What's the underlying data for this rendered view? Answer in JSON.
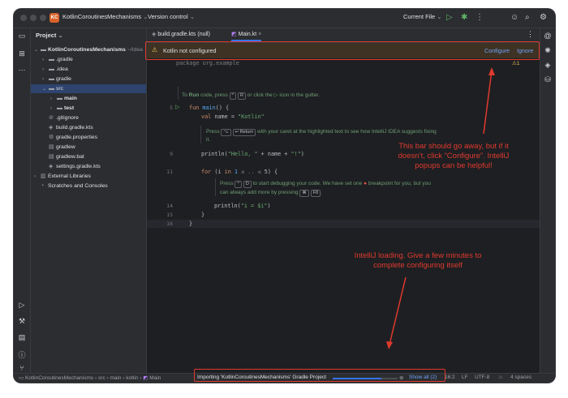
{
  "titlebar": {
    "project_badge": "KC",
    "project_name": "KotlinCoroutinesMechanisms",
    "version_control": "Version control",
    "run_config": "Current File"
  },
  "tool_window": {
    "title": "Project"
  },
  "tree": [
    {
      "label": "KotlinCoroutinesMechanisms",
      "suffix": "~/Idea",
      "chev": "⌄",
      "icon": "folder-icon"
    },
    {
      "label": ".gradle",
      "chev": "›",
      "icon": "folder-icon"
    },
    {
      "label": ".idea",
      "chev": "›",
      "icon": "folder-icon"
    },
    {
      "label": "gradle",
      "chev": "›",
      "icon": "folder-icon"
    },
    {
      "label": "src",
      "chev": "⌄",
      "icon": "folder-icon"
    },
    {
      "label": "main",
      "chev": "›",
      "icon": "folder-icon"
    },
    {
      "label": "test",
      "chev": "›",
      "icon": "folder-icon"
    },
    {
      "label": ".gitignore",
      "chev": "",
      "icon": "file-icon"
    },
    {
      "label": "build.gradle.kts",
      "chev": "",
      "icon": "file-icon"
    },
    {
      "label": "gradle.properties",
      "chev": "",
      "icon": "file-icon"
    },
    {
      "label": "gradlew",
      "chev": "",
      "icon": "file-icon"
    },
    {
      "label": "gradlew.bat",
      "chev": "",
      "icon": "file-icon"
    },
    {
      "label": "settings.gradle.kts",
      "chev": "",
      "icon": "file-icon"
    },
    {
      "label": "External Libraries",
      "chev": "›",
      "icon": "library-icon"
    },
    {
      "label": "Scratches and Consoles",
      "chev": "",
      "icon": "scratch-icon"
    }
  ],
  "tabs": [
    {
      "label": "build.gradle.kts (null)"
    },
    {
      "label": "Main.kt"
    }
  ],
  "notification": {
    "text": "Kotlin not configured",
    "configure": "Configure",
    "ignore": "Ignore"
  },
  "editor": {
    "line1": "package org.example",
    "hint1_a": "To ",
    "hint1_b": "Run",
    "hint1_c": " code, press ",
    "hint1_k1": "^",
    "hint1_k2": "R",
    "hint1_d": " or click the ",
    "hint1_e": " icon in the gutter.",
    "fun": "fun",
    "main": "main",
    "fun_rest": "() {",
    "val": "val",
    "name_eq": " name = ",
    "kotlin_str": "\"Kotlin\"",
    "hint2_a": "Press ",
    "hint2_k1": "⌥",
    "hint2_k2": "↩ Return",
    "hint2_b": " with your caret at the highlighted text to see how IntelliJ IDEA suggests fixing",
    "hint2_c": "it.",
    "println1_a": "println(",
    "println1_b": "\"Hello, \"",
    "println1_c": " + name + ",
    "println1_d": "\"!\"",
    "println1_e": ")",
    "for": "for",
    "for_a": " (i ",
    "for_in": "in",
    "for_b": " 1",
    "for_r": " ≤ .. ≤ ",
    "for_c": "5) {",
    "hint3_a": "Press ",
    "hint3_k1": "^",
    "hint3_k2": "D",
    "hint3_b": " to start debugging your code. We have set one ",
    "hint3_c": " breakpoint for you, but you",
    "hint3_d": "can always add more by pressing ",
    "hint3_k3": "⌘",
    "hint3_k4": "F8",
    "hint3_e": ".",
    "println2_a": "println(",
    "println2_b": "\"i = $i\"",
    "println2_c": ")",
    "close1": "}",
    "close2": "}",
    "gutter": [
      "5",
      "9",
      "11",
      "14",
      "15",
      "16"
    ],
    "warn_count": "1"
  },
  "statusbar": {
    "crumbs": [
      "KotlinCoroutinesMechanisms",
      "src",
      "main",
      "kotlin",
      "Main"
    ],
    "task": "Importing 'KotlinCoroutinesMechanisms' Gradle Project",
    "progress": 0.75,
    "show_all": "Show all (2)",
    "position": "16:2",
    "line_sep": "LF",
    "encoding": "UTF-8",
    "indent": "4 spaces"
  },
  "annotations": {
    "bar_note": "This bar should go away, but if it doesn’t, click “Configure”. IntelliJ popups can be helpful!",
    "loading_note": "IntelliJ loading. Give a few minutes to complete configuring itself"
  },
  "colors": {
    "accent": "#3574f0",
    "annotation": "#e03a2e",
    "notification_bg": "#3d3223"
  }
}
